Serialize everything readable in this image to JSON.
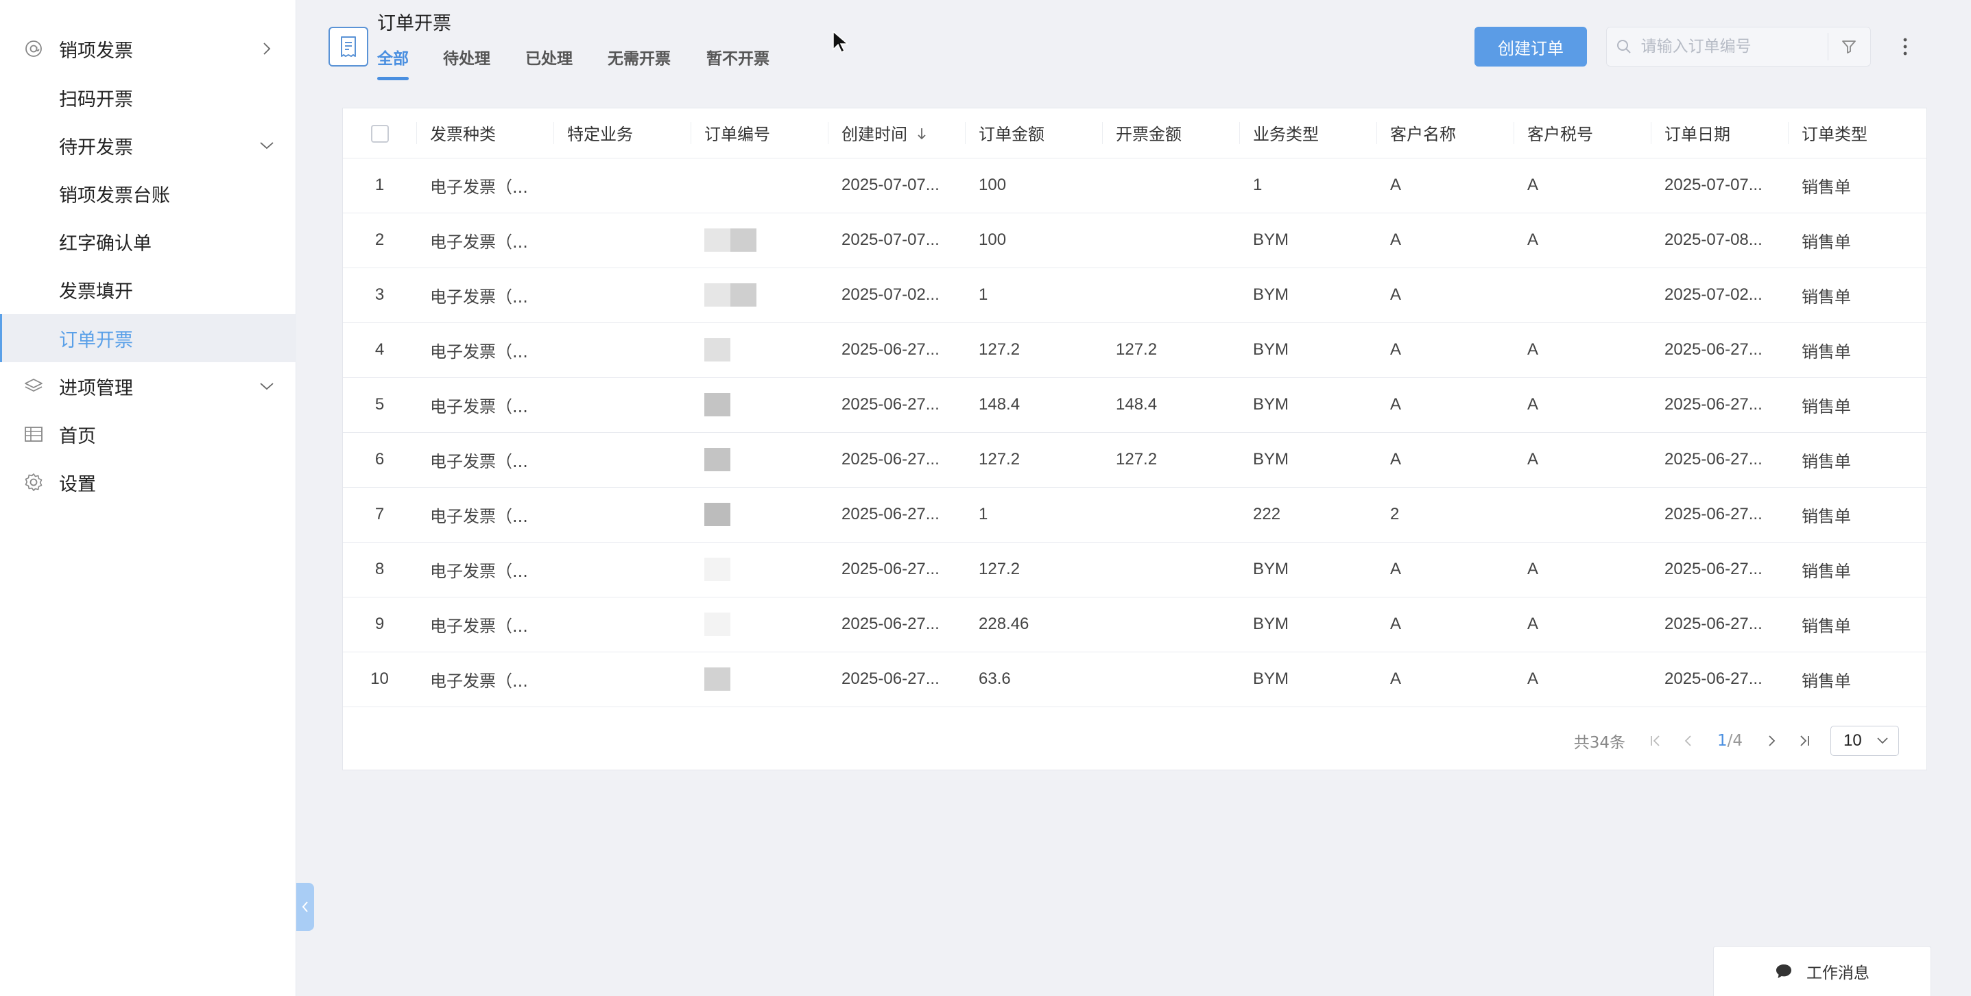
{
  "sidebar": {
    "items": [
      {
        "label": "销项发票",
        "icon": "at-icon",
        "expand": "right"
      },
      {
        "label": "扫码开票"
      },
      {
        "label": "待开发票",
        "expand": "down"
      },
      {
        "label": "销项发票台账"
      },
      {
        "label": "红字确认单"
      },
      {
        "label": "发票填开"
      },
      {
        "label": "订单开票",
        "active": true
      },
      {
        "label": "进项管理",
        "icon": "layers-icon",
        "expand": "down"
      },
      {
        "label": "首页",
        "icon": "table-icon"
      },
      {
        "label": "设置",
        "icon": "gear-icon"
      }
    ]
  },
  "header": {
    "title": "订单开票",
    "tabs": [
      "全部",
      "待处理",
      "已处理",
      "无需开票",
      "暂不开票"
    ],
    "active_tab": 0,
    "create_label": "创建订单",
    "search_placeholder": "请输入订单编号",
    "search_value": ""
  },
  "table": {
    "columns": [
      "发票种类",
      "特定业务",
      "订单编号",
      "创建时间",
      "订单金额",
      "开票金额",
      "业务类型",
      "客户名称",
      "客户税号",
      "订单日期",
      "订单类型"
    ],
    "rows": [
      {
        "idx": "1",
        "kind": "电子发票（...",
        "special": "",
        "order_no": "",
        "created": "2025-07-07...",
        "amount": "100",
        "invoice_amount": "",
        "biz_type": "1",
        "customer": "A",
        "tax_no": "A",
        "order_date": "2025-07-07...",
        "order_type": "销售单"
      },
      {
        "idx": "2",
        "kind": "电子发票（...",
        "special": "",
        "order_no": "",
        "created": "2025-07-07...",
        "amount": "100",
        "invoice_amount": "",
        "biz_type": "BYM",
        "customer": "A",
        "tax_no": "A",
        "order_date": "2025-07-08...",
        "order_type": "销售单"
      },
      {
        "idx": "3",
        "kind": "电子发票（...",
        "special": "",
        "order_no": "",
        "created": "2025-07-02...",
        "amount": "1",
        "invoice_amount": "",
        "biz_type": "BYM",
        "customer": "A",
        "tax_no": "",
        "order_date": "2025-07-02...",
        "order_type": "销售单"
      },
      {
        "idx": "4",
        "kind": "电子发票（...",
        "special": "",
        "order_no": "",
        "created": "2025-06-27...",
        "amount": "127.2",
        "invoice_amount": "127.2",
        "biz_type": "BYM",
        "customer": "A",
        "tax_no": "A",
        "order_date": "2025-06-27...",
        "order_type": "销售单"
      },
      {
        "idx": "5",
        "kind": "电子发票（...",
        "special": "",
        "order_no": "",
        "created": "2025-06-27...",
        "amount": "148.4",
        "invoice_amount": "148.4",
        "biz_type": "BYM",
        "customer": "A",
        "tax_no": "A",
        "order_date": "2025-06-27...",
        "order_type": "销售单"
      },
      {
        "idx": "6",
        "kind": "电子发票（...",
        "special": "",
        "order_no": "",
        "created": "2025-06-27...",
        "amount": "127.2",
        "invoice_amount": "127.2",
        "biz_type": "BYM",
        "customer": "A",
        "tax_no": "A",
        "order_date": "2025-06-27...",
        "order_type": "销售单"
      },
      {
        "idx": "7",
        "kind": "电子发票（...",
        "special": "",
        "order_no": "",
        "created": "2025-06-27...",
        "amount": "1",
        "invoice_amount": "",
        "biz_type": "222",
        "customer": "2",
        "tax_no": "",
        "order_date": "2025-06-27...",
        "order_type": "销售单"
      },
      {
        "idx": "8",
        "kind": "电子发票（...",
        "special": "",
        "order_no": "",
        "created": "2025-06-27...",
        "amount": "127.2",
        "invoice_amount": "",
        "biz_type": "BYM",
        "customer": "A",
        "tax_no": "A",
        "order_date": "2025-06-27...",
        "order_type": "销售单"
      },
      {
        "idx": "9",
        "kind": "电子发票（...",
        "special": "",
        "order_no": "",
        "created": "2025-06-27...",
        "amount": "228.46",
        "invoice_amount": "",
        "biz_type": "BYM",
        "customer": "A",
        "tax_no": "A",
        "order_date": "2025-06-27...",
        "order_type": "销售单"
      },
      {
        "idx": "10",
        "kind": "电子发票（...",
        "special": "",
        "order_no": "",
        "created": "2025-06-27...",
        "amount": "63.6",
        "invoice_amount": "",
        "biz_type": "BYM",
        "customer": "A",
        "tax_no": "A",
        "order_date": "2025-06-27...",
        "order_type": "销售单"
      }
    ]
  },
  "pagination": {
    "total": "共34条",
    "current": "1",
    "pages": "/4",
    "page_size": "10"
  },
  "work_message": {
    "label": "工作消息"
  },
  "colors": {
    "accent": "#4a8fe0",
    "button": "#5b9ce6",
    "sidebar_active_bg": "#eceef3",
    "page_bg": "#f0f1f5"
  }
}
